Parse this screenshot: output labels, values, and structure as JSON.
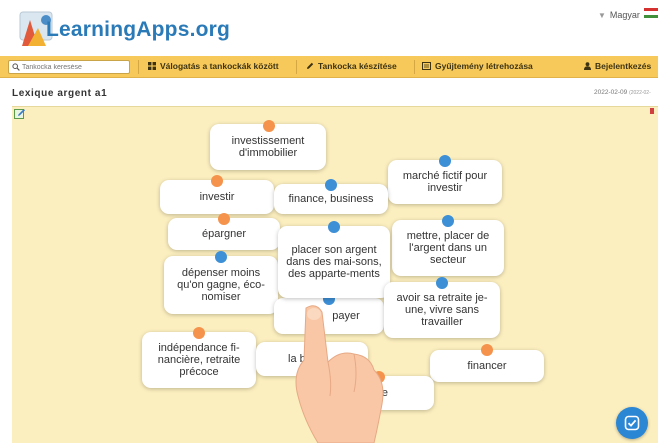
{
  "header": {
    "logo_text": "LearningApps.org",
    "language": "Magyar"
  },
  "navbar": {
    "search_placeholder": "Tankocka keresése",
    "items": [
      {
        "label": "Válogatás a tankockák között",
        "icon": "grid-icon"
      },
      {
        "label": "Tankocka készítése",
        "icon": "pencil-icon"
      },
      {
        "label": "Gyűjtemény létrehozása",
        "icon": "collection-icon"
      },
      {
        "label": "Bejelentkezés",
        "icon": "user-icon"
      }
    ]
  },
  "page": {
    "title": "Lexique argent a1",
    "date": "2022-02-09",
    "date_small": "(2022-02-"
  },
  "cards": [
    {
      "text": "investissement d'immobilier",
      "pin": "orange"
    },
    {
      "text": "marché fictif pour investir",
      "pin": "blue"
    },
    {
      "text": "investir",
      "pin": "orange"
    },
    {
      "text": "finance, business",
      "pin": "blue"
    },
    {
      "text": "épargner",
      "pin": "orange"
    },
    {
      "text": "mettre, placer de l'argent dans un secteur",
      "pin": "blue"
    },
    {
      "text": "placer son argent dans des mai-sons, des apparte-ments",
      "pin": "blue"
    },
    {
      "text": "dépenser moins qu'on gagne, éco-nomiser",
      "pin": "blue"
    },
    {
      "text": "payer",
      "pin": "blue"
    },
    {
      "text": "avoir sa retraite je-une, vivre sans travailler",
      "pin": "blue"
    },
    {
      "text": "indépendance fi-nancière, retraite précoce",
      "pin": "orange"
    },
    {
      "text": "la bo",
      "pin": "none"
    },
    {
      "text": "financer",
      "pin": "orange"
    },
    {
      "text": "re",
      "pin": "orange"
    }
  ],
  "colors": {
    "orange_pin": "#f5934c",
    "blue_pin": "#3d8fd6",
    "nav_bar": "#f7c95a",
    "board": "#fcefbf",
    "logo_blue": "#2a7ab8"
  }
}
